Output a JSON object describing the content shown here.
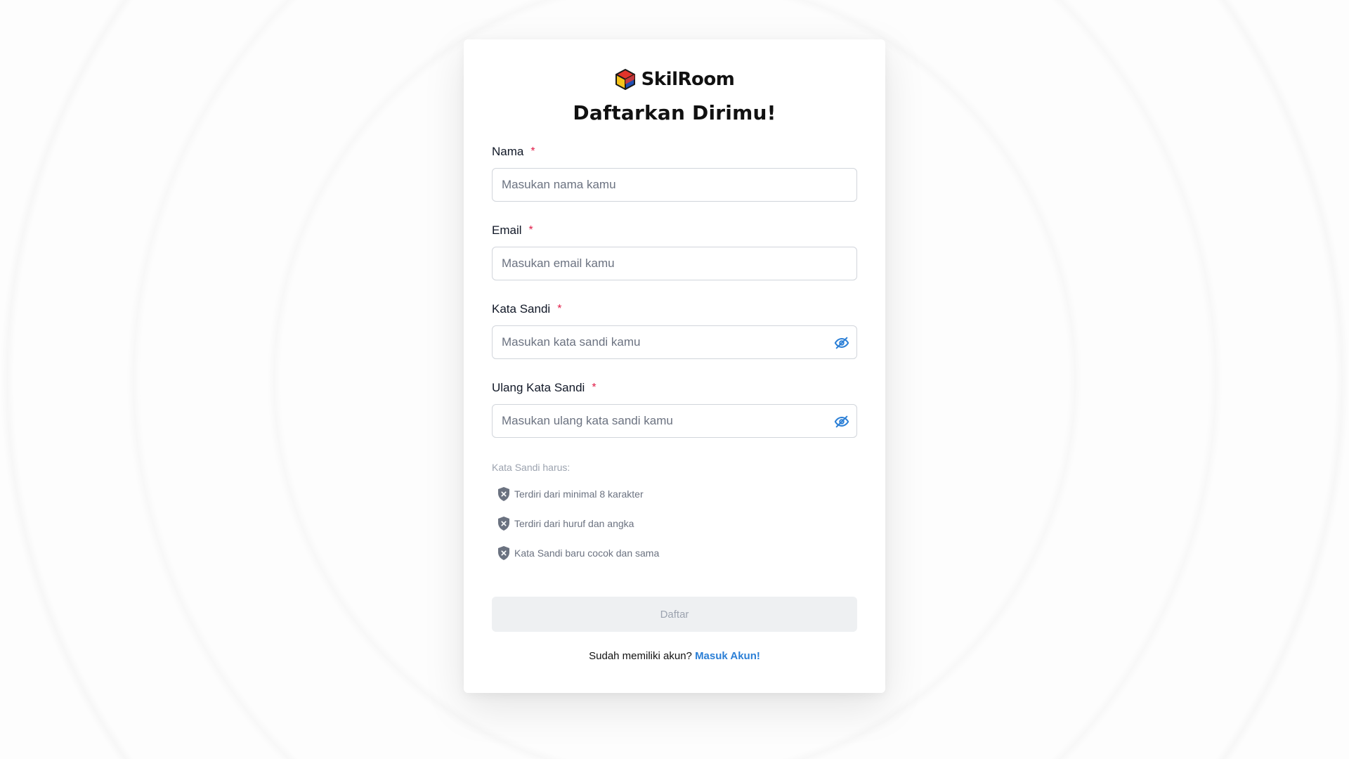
{
  "brand": {
    "name": "SkilRoom",
    "logo_icon": "cube-logo-icon",
    "colors": {
      "yellow": "#f6c31a",
      "red": "#e1342b",
      "blue": "#1f4fb3",
      "outline": "#1a1a1a"
    }
  },
  "page": {
    "title": "Daftarkan Dirimu!"
  },
  "form": {
    "required_mark": "*",
    "name": {
      "label": "Nama",
      "placeholder": "Masukan nama kamu",
      "value": ""
    },
    "email": {
      "label": "Email",
      "placeholder": "Masukan email kamu",
      "value": ""
    },
    "password": {
      "label": "Kata Sandi",
      "placeholder": "Masukan kata sandi kamu",
      "value": "",
      "toggle_icon": "eye-off-icon"
    },
    "confirm_password": {
      "label": "Ulang Kata Sandi",
      "placeholder": "Masukan ulang kata sandi kamu",
      "value": "",
      "toggle_icon": "eye-off-icon"
    }
  },
  "password_rules": {
    "title": "Kata Sandi harus:",
    "status_icon": "shield-x-icon",
    "items": [
      {
        "text": "Terdiri dari minimal 8 karakter",
        "met": false
      },
      {
        "text": "Terdiri dari huruf dan angka",
        "met": false
      },
      {
        "text": "Kata Sandi baru cocok dan sama",
        "met": false
      }
    ]
  },
  "submit": {
    "label": "Daftar",
    "disabled": true
  },
  "footer": {
    "prompt": "Sudah memiliki akun?",
    "link_label": "Masuk Akun!"
  },
  "colors": {
    "accent": "#2b7fd6",
    "required": "#e11d48",
    "disabled_bg": "#eef0f2"
  }
}
